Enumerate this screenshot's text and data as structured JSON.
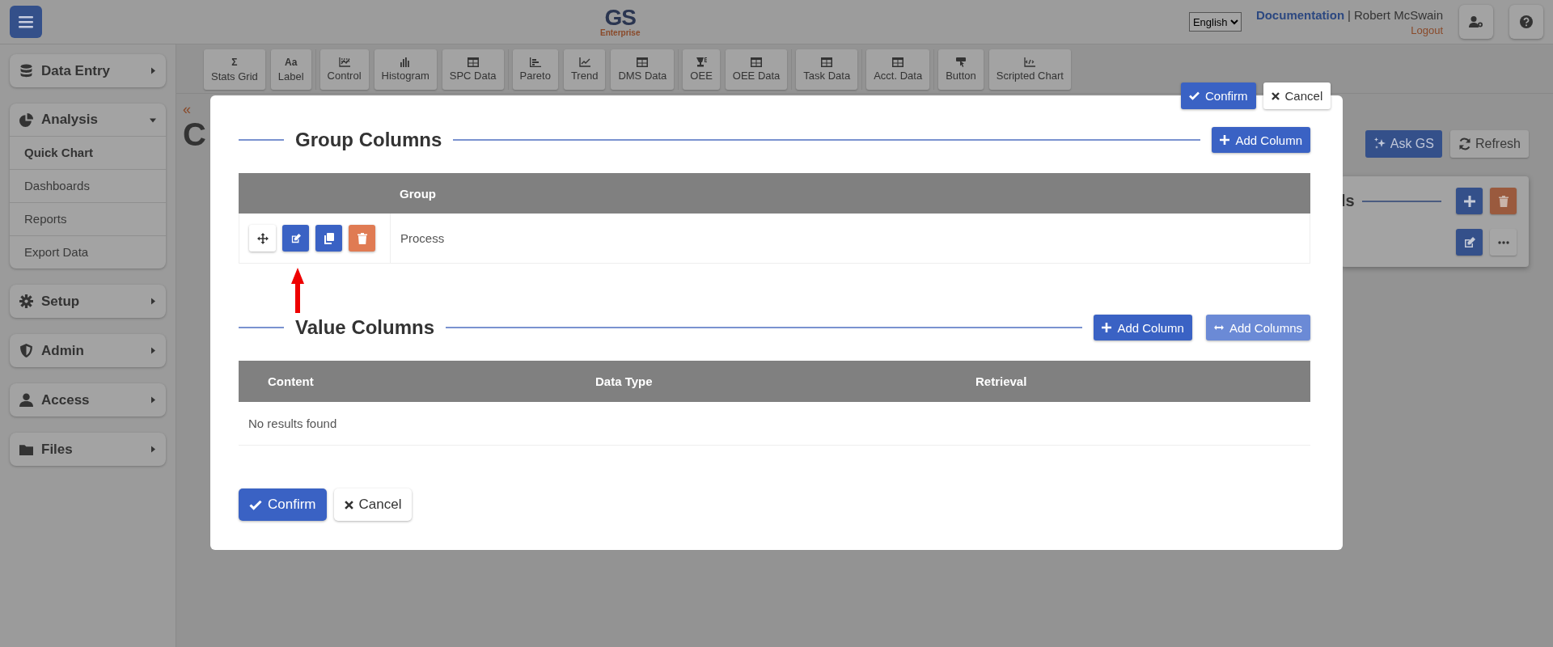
{
  "header": {
    "logo": "GS",
    "logo_sub": "Enterprise",
    "language": "English",
    "documentation": "Documentation",
    "separator": "|",
    "user": "Robert McSwain",
    "logout": "Logout"
  },
  "toolbar": [
    [
      {
        "glyph": "Σ",
        "label": "Stats Grid"
      },
      {
        "glyph": "Aa",
        "label": "Label"
      }
    ],
    [
      {
        "label": "Control"
      },
      {
        "label": "Histogram"
      },
      {
        "label": "SPC Data"
      }
    ],
    [
      {
        "label": "Pareto"
      },
      {
        "label": "Trend"
      },
      {
        "label": "DMS Data"
      }
    ],
    [
      {
        "label": "OEE"
      },
      {
        "label": "OEE Data"
      }
    ],
    [
      {
        "label": "Task Data"
      }
    ],
    [
      {
        "label": "Acct. Data"
      }
    ],
    [
      {
        "label": "Button"
      },
      {
        "label": "Scripted Chart"
      }
    ]
  ],
  "sidebar": [
    {
      "label": "Data Entry",
      "expanded": false
    },
    {
      "label": "Analysis",
      "expanded": true,
      "children": [
        {
          "label": "Quick Chart",
          "selected": true
        },
        {
          "label": "Dashboards",
          "selected": false
        },
        {
          "label": "Reports",
          "selected": false
        },
        {
          "label": "Export Data",
          "selected": false
        }
      ]
    },
    {
      "label": "Setup",
      "expanded": false
    },
    {
      "label": "Admin",
      "expanded": false
    },
    {
      "label": "Access",
      "expanded": false
    },
    {
      "label": "Files",
      "expanded": false
    }
  ],
  "page": {
    "breadcrumb": "«",
    "title": "C",
    "ask": "Ask GS",
    "refresh": "Refresh",
    "panel_title": "ls"
  },
  "modal": {
    "top_actions": [
      "Confirm",
      "Cancel"
    ],
    "group_section": {
      "title": "Group Columns",
      "add_button": "Add Column",
      "columns": [
        "Group"
      ],
      "rows": [
        {
          "group": "Process"
        }
      ]
    },
    "value_section": {
      "title": "Value Columns",
      "buttons": [
        "Add Column",
        "Add Columns"
      ],
      "columns": [
        "Content",
        "Data Type",
        "Retrieval"
      ],
      "empty": "No results found"
    },
    "footer": [
      "Confirm",
      "Cancel"
    ]
  }
}
